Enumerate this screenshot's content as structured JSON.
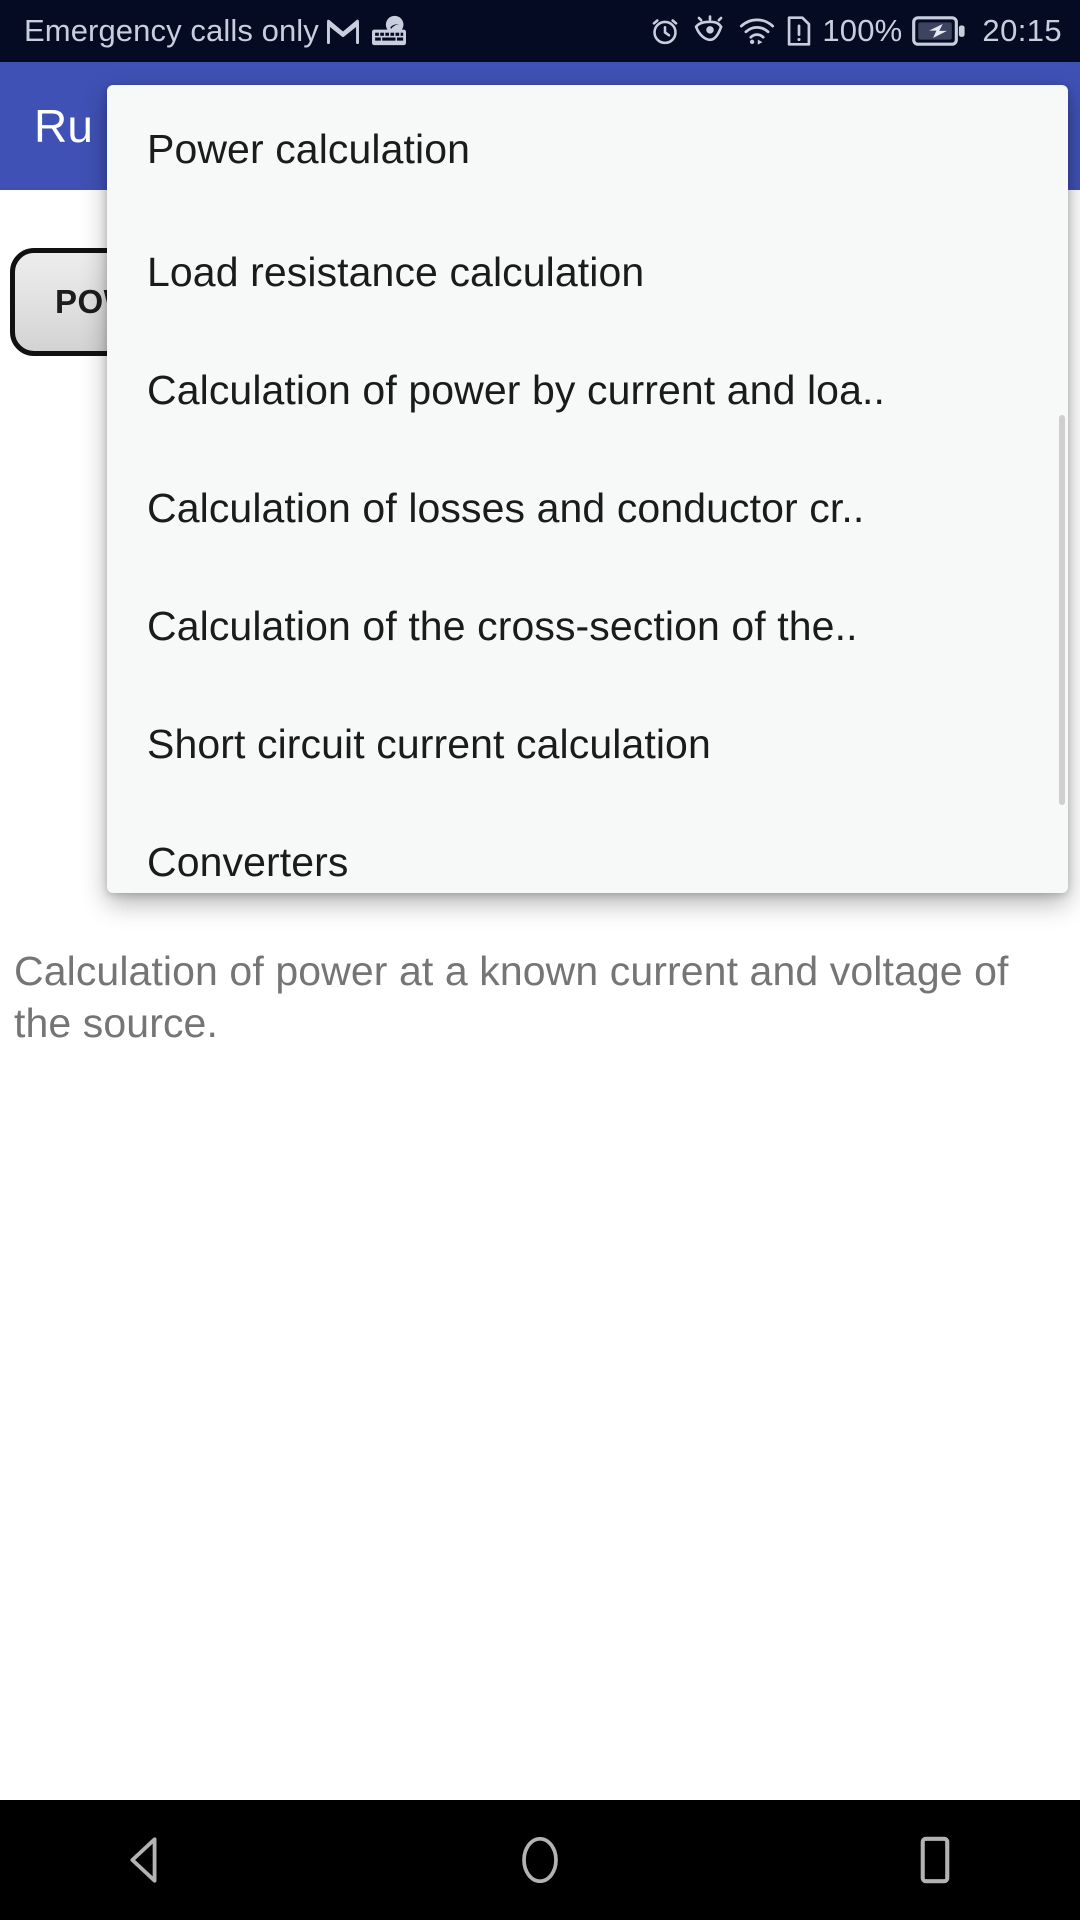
{
  "status_bar": {
    "carrier_text": "Emergency calls only",
    "left_icons": [
      "gmail-icon",
      "keyboard-icon"
    ],
    "right_icons": [
      "alarm-icon",
      "eye-comfort-icon",
      "wifi-icon",
      "sim-alert-icon"
    ],
    "battery_percent": "100%",
    "battery_icon": "battery-charging-icon",
    "clock": "20:15",
    "background_color": "#060b24",
    "text_color": "#c9cede"
  },
  "app_bar": {
    "title": "Ru",
    "background_color": "#3f51b5",
    "title_color": "#ffffff"
  },
  "main": {
    "spinner_button_label": "POWER CALCULATION",
    "description": "Calculation of power at a known current and voltage of the source."
  },
  "dropdown": {
    "items": [
      {
        "label": "Power calculation"
      },
      {
        "label": "Load resistance calculation"
      },
      {
        "label": "Calculation of power by current and loa.."
      },
      {
        "label": "Calculation of losses and conductor cr.."
      },
      {
        "label": "Calculation of the cross-section of the.."
      },
      {
        "label": "Short circuit current calculation"
      },
      {
        "label": "Converters"
      }
    ],
    "background_color": "#f7f8f8",
    "text_color": "#1b1b1b"
  },
  "nav_bar": {
    "buttons": [
      "back-icon",
      "home-icon",
      "recents-icon"
    ],
    "background_color": "#000000"
  }
}
